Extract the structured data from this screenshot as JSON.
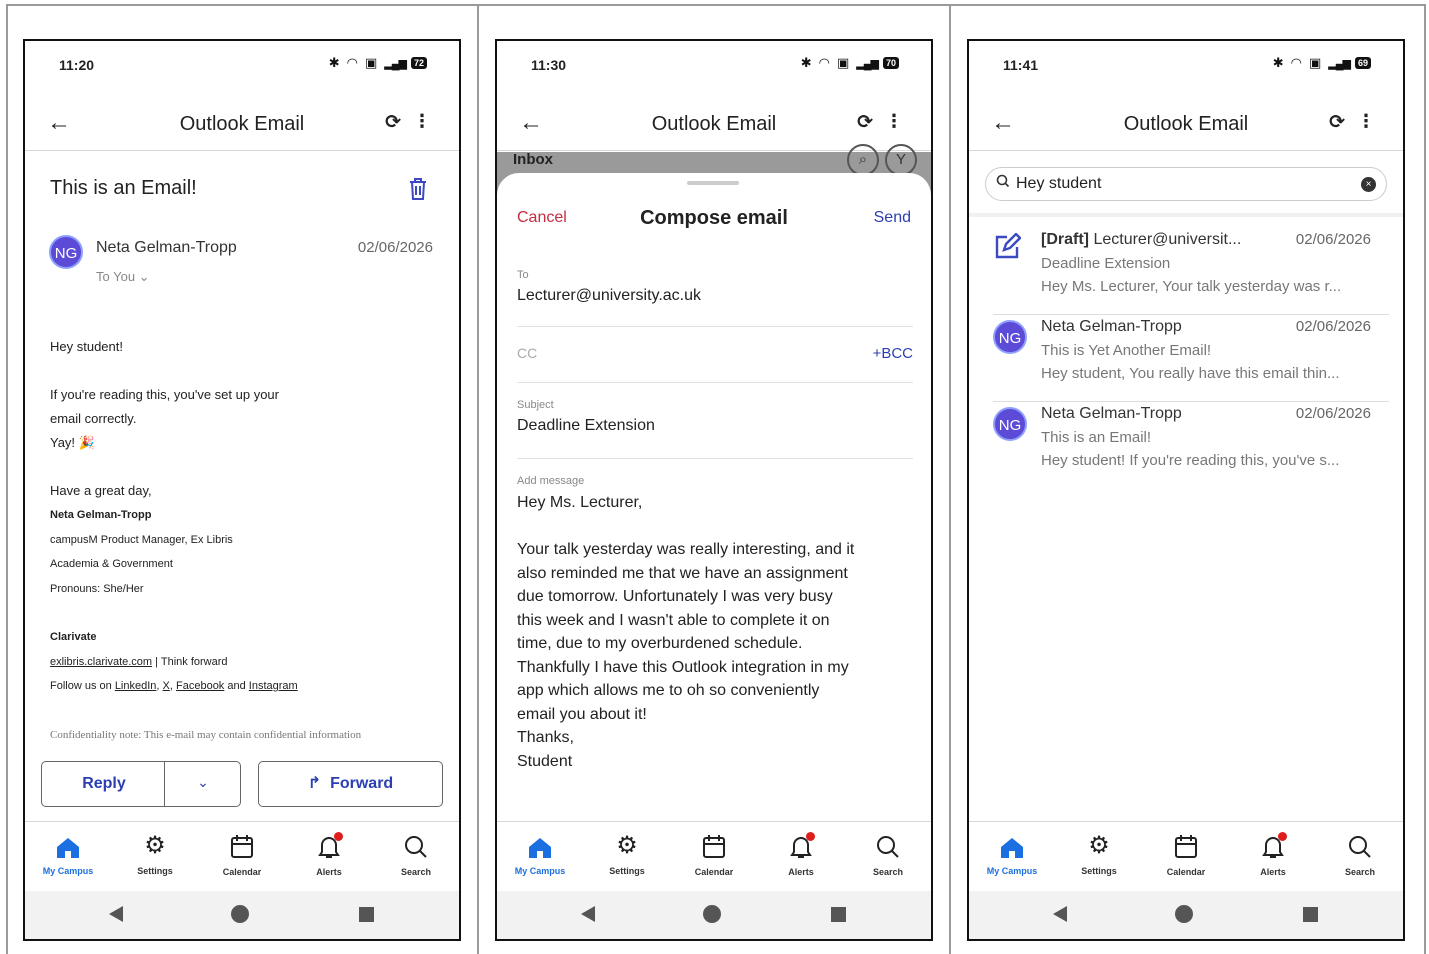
{
  "common": {
    "app_title": "Outlook Email",
    "tabs": [
      "My Campus",
      "Settings",
      "Calendar",
      "Alerts",
      "Search"
    ],
    "avatar_initials": "NG",
    "colors": {
      "accent": "#2b3fb3",
      "active_tab": "#1b6fe0",
      "cancel": "#c62b40",
      "alert_dot": "#e01d1d"
    }
  },
  "phone1": {
    "time": "11:20",
    "battery": "72",
    "subject": "This is an Email!",
    "sender": "Neta Gelman-Tropp",
    "date": "02/06/2026",
    "to": "To You",
    "body": {
      "greeting": "Hey student!",
      "line1": "If you're reading this, you've set up your",
      "line2": "email correctly.",
      "line3": "Yay! 🎉",
      "closing": "Have a great day,",
      "sig_name": "Neta Gelman-Tropp",
      "sig_title": "campusM Product Manager, Ex Libris",
      "sig_dept": "Academia & Government",
      "sig_pronouns": "Pronouns: She/Her",
      "company": "Clarivate",
      "site_link": "exlibris.clarivate.com",
      "site_tagline": " | Think forward",
      "follow_prefix": "Follow us on ",
      "linkedin": "LinkedIn",
      "x": "X",
      "facebook": "Facebook",
      "and": " and ",
      "instagram": "Instagram",
      "confidentiality": "Confidentiality note: This e-mail may contain confidential information"
    },
    "reply_label": "Reply",
    "forward_label": "Forward"
  },
  "phone2": {
    "time": "11:30",
    "battery": "70",
    "background_label": "Inbox",
    "cancel_label": "Cancel",
    "sheet_title": "Compose email",
    "send_label": "Send",
    "to_label": "To",
    "to_value": "Lecturer@university.ac.uk",
    "cc_label": "CC",
    "bcc_label": "+BCC",
    "subject_label": "Subject",
    "subject_value": "Deadline Extension",
    "message_label": "Add message",
    "message_lines": [
      "Hey Ms. Lecturer,",
      "",
      "Your talk yesterday was really interesting, and it",
      "also reminded me that we have an assignment",
      "due tomorrow. Unfortunately I was very busy",
      "this week and I wasn't able to complete it on",
      "time, due to my overburdened schedule.",
      "Thankfully I have this Outlook integration in my",
      "app which allows me to oh so conveniently",
      "email you about it!",
      "Thanks,",
      "Student"
    ]
  },
  "phone3": {
    "time": "11:41",
    "battery": "69",
    "search_value": "Hey student",
    "results": [
      {
        "line1_bold": "[Draft]",
        "line1_rest": " Lecturer@universit...",
        "date": "02/06/2026",
        "line2": "Deadline Extension",
        "line3": "Hey Ms. Lecturer, Your talk yesterday was r..."
      },
      {
        "line1_bold": "",
        "line1_rest": "Neta Gelman-Tropp",
        "date": "02/06/2026",
        "line2": "This is Yet Another Email!",
        "line3": "Hey student, You really have this email thin..."
      },
      {
        "line1_bold": "",
        "line1_rest": "Neta Gelman-Tropp",
        "date": "02/06/2026",
        "line2": "This is an Email!",
        "line3": "Hey student! If you're reading this, you've s..."
      }
    ]
  }
}
